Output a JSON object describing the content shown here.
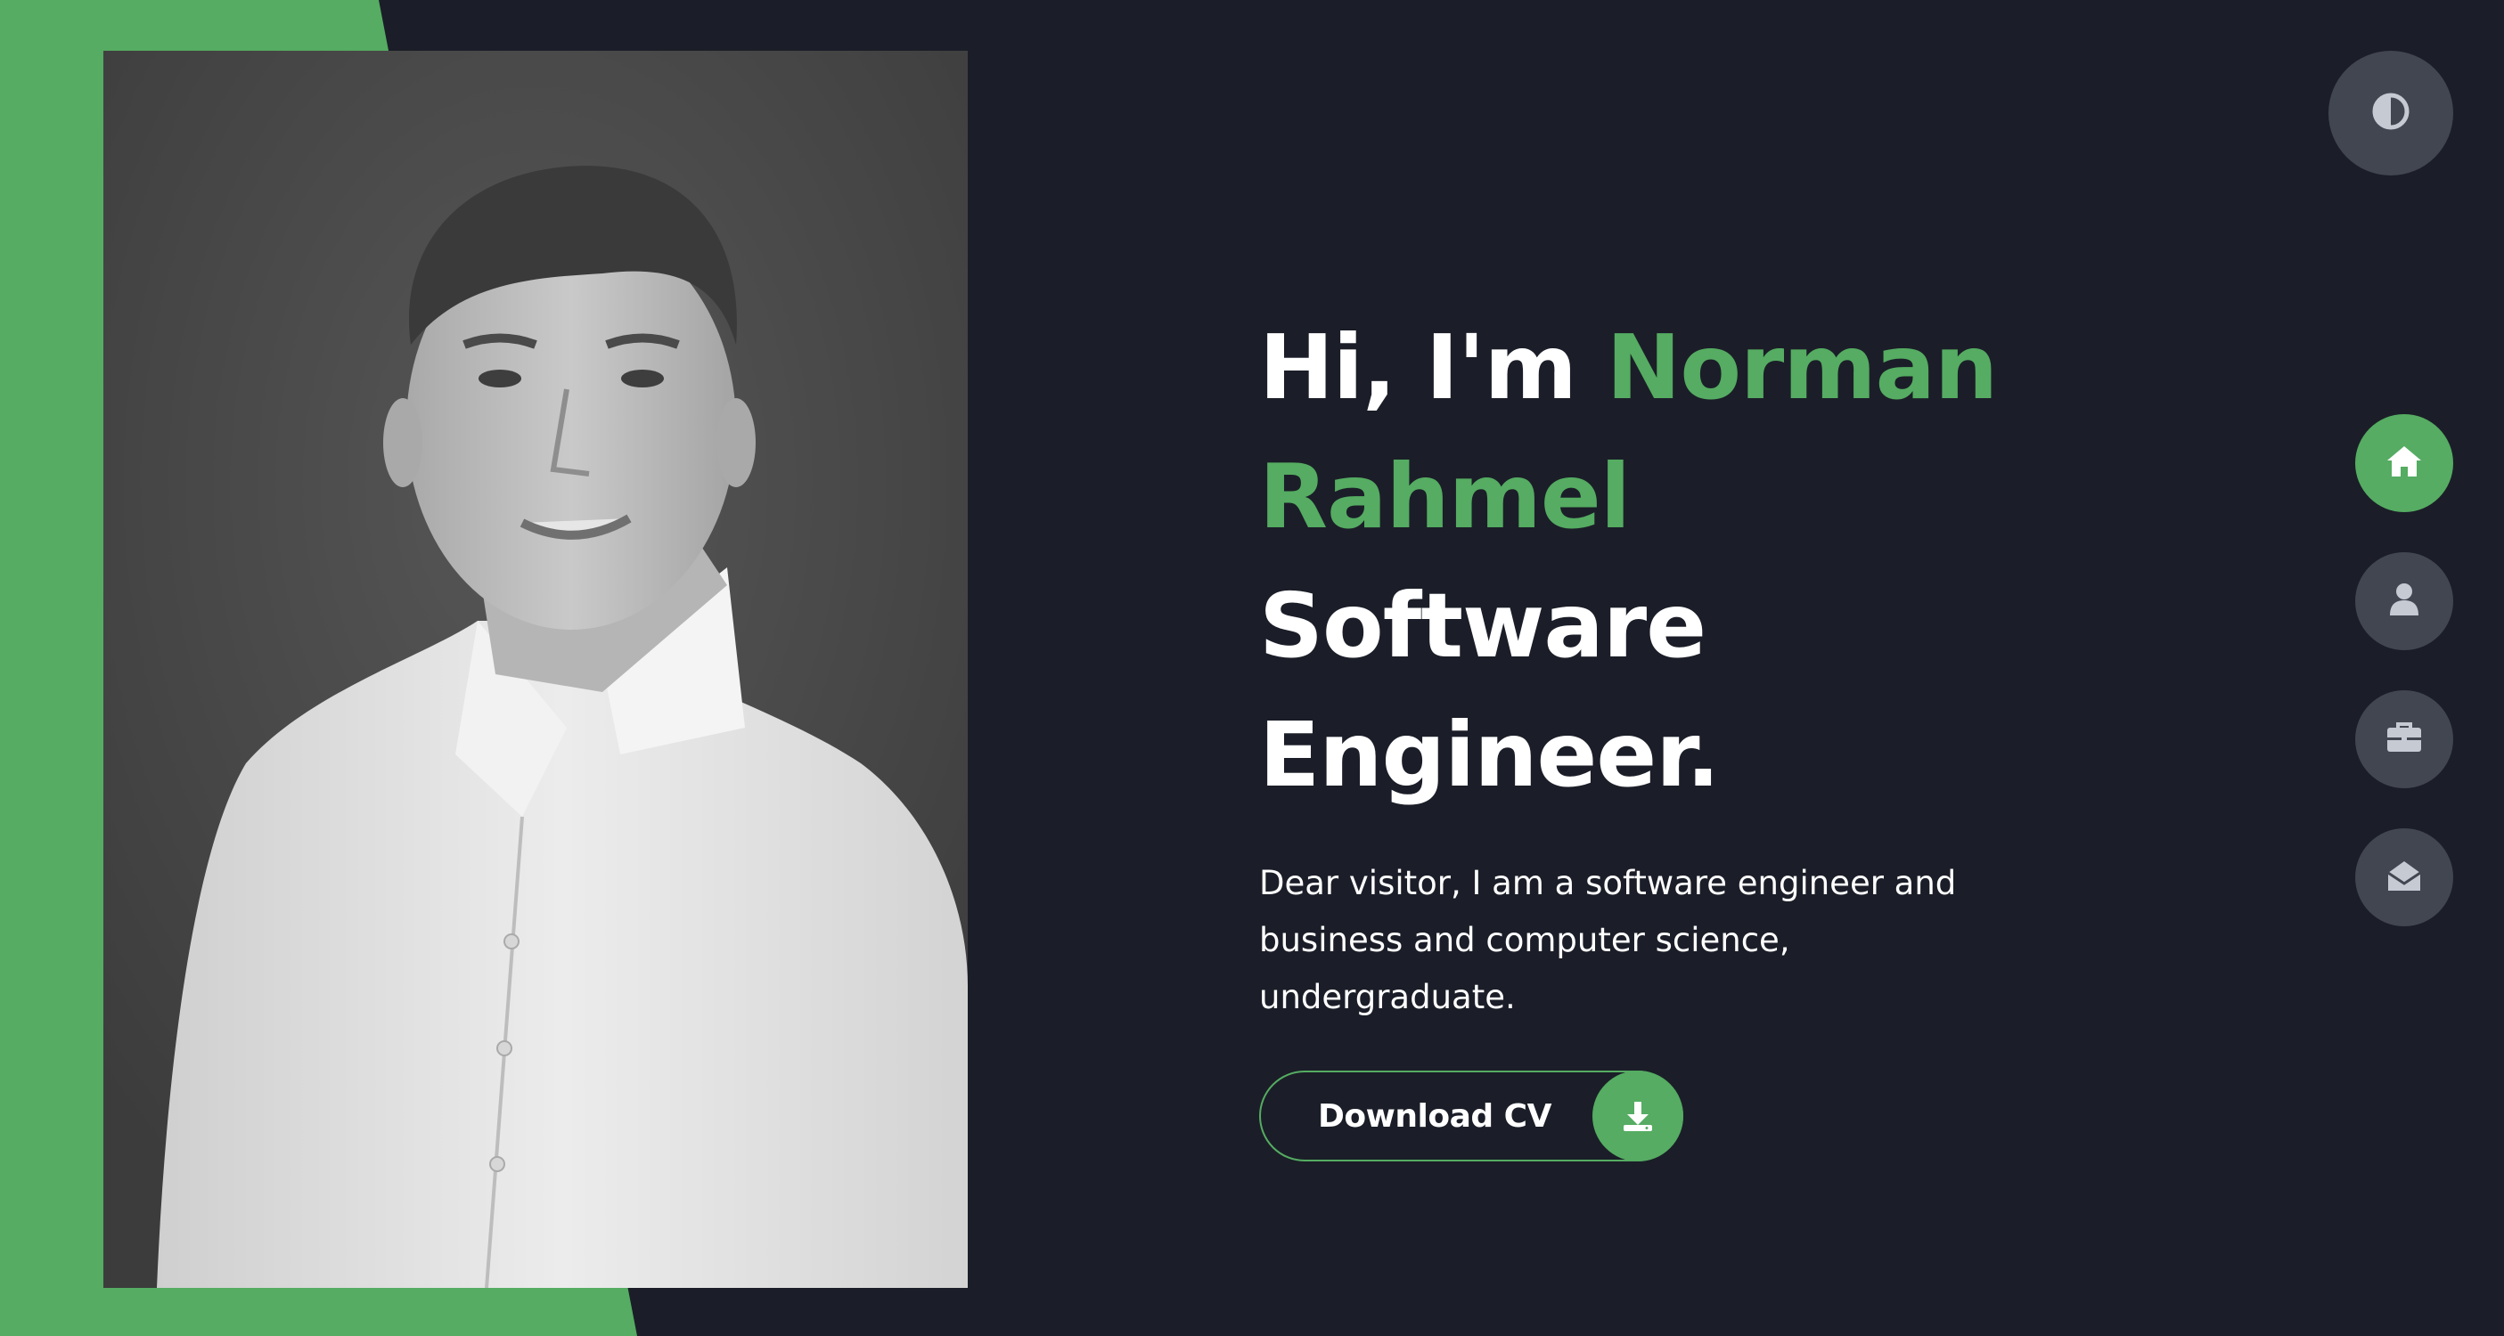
{
  "colors": {
    "background": "#1b1e28",
    "accent": "#55ac62",
    "button_gray": "#424651",
    "text": "#ffffff",
    "icon_gray": "#c5cad3"
  },
  "hero": {
    "greeting": "Hi, I'm",
    "name_first": "Norman",
    "name_last": "Rahmel",
    "role": "Software Engineer.",
    "description": "Dear visitor, I am a software engineer and business and computer science, undergraduate.",
    "cv_button_label": "Download CV",
    "cv_button_icon": "download-icon"
  },
  "photo": {
    "subject": "portrait-photo"
  },
  "theme_toggle": {
    "icon": "contrast-icon"
  },
  "nav": {
    "items": [
      {
        "id": "home",
        "icon": "home-icon",
        "active": true
      },
      {
        "id": "about",
        "icon": "user-icon",
        "active": false
      },
      {
        "id": "portfolio",
        "icon": "briefcase-icon",
        "active": false
      },
      {
        "id": "contact",
        "icon": "envelope-open-icon",
        "active": false
      }
    ]
  }
}
